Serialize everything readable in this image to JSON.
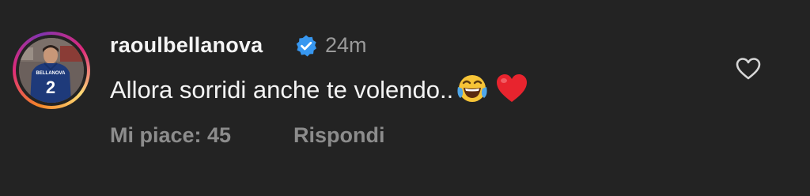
{
  "comment": {
    "username": "raoulbellanova",
    "time": "24m",
    "text": "Allora sorridi anche te volendo..",
    "emojis": [
      "face-with-tears-of-joy",
      "red-heart"
    ],
    "likes_label": "Mi piace: 45",
    "reply_label": "Rispondi",
    "avatar": {
      "jersey_name": "BELLANOVA",
      "jersey_number": "2"
    },
    "icons": {
      "verified": "verified-badge-icon",
      "like": "heart-outline-icon"
    },
    "colors": {
      "background": "#232323",
      "verified": "#3797f0",
      "secondary_text": "#8c8c8c"
    }
  }
}
